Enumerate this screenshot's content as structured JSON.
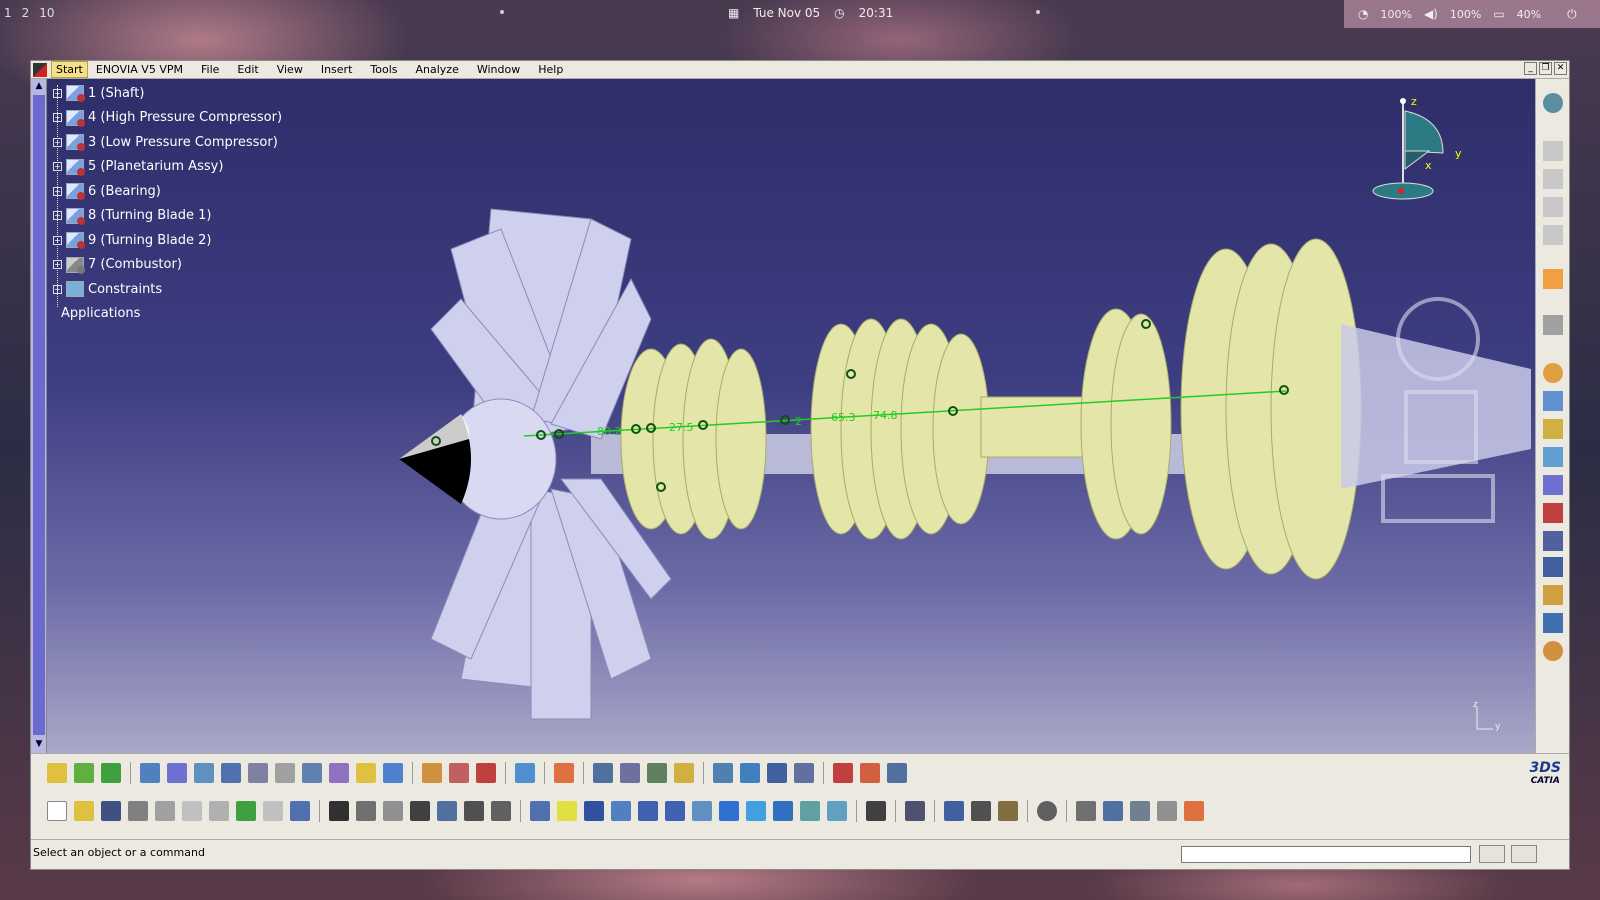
{
  "desktop": {
    "workspaces": [
      "1",
      "2",
      "10"
    ],
    "date": "Tue Nov 05",
    "time": "20:31",
    "wifi": "100%",
    "volume": "100%",
    "battery": "40%"
  },
  "menu": {
    "start": "Start",
    "items": [
      "ENOVIA V5 VPM",
      "File",
      "Edit",
      "View",
      "Insert",
      "Tools",
      "Analyze",
      "Window",
      "Help"
    ]
  },
  "tree": {
    "nodes": [
      "1 (Shaft)",
      "4 (High Pressure Compressor)",
      "3 (Low Pressure Compressor)",
      "5 (Planetarium Assy)",
      "6 (Bearing)",
      "8 (Turning Blade 1)",
      "9 (Turning Blade 2)",
      "7 (Combustor)",
      "Constraints"
    ],
    "applications": "Applications"
  },
  "model": {
    "dimensions": [
      "80.2",
      "27.5",
      "2",
      "65.3",
      "74.8"
    ]
  },
  "compass": {
    "z": "z",
    "x": "x",
    "y": "y"
  },
  "axis_triad": {
    "z": "z",
    "y": "y"
  },
  "branding": {
    "ds": "3DS",
    "product": "CATIA"
  },
  "status": {
    "message": "Select an object or a command",
    "command_input": ""
  },
  "colors": {
    "viewport_top": "#2f2e6a",
    "viewport_bottom": "#a9a8c8",
    "part_green": "#e3e6a8",
    "fan_lavender": "#c9cae8",
    "dimension_green": "#22cc22"
  }
}
